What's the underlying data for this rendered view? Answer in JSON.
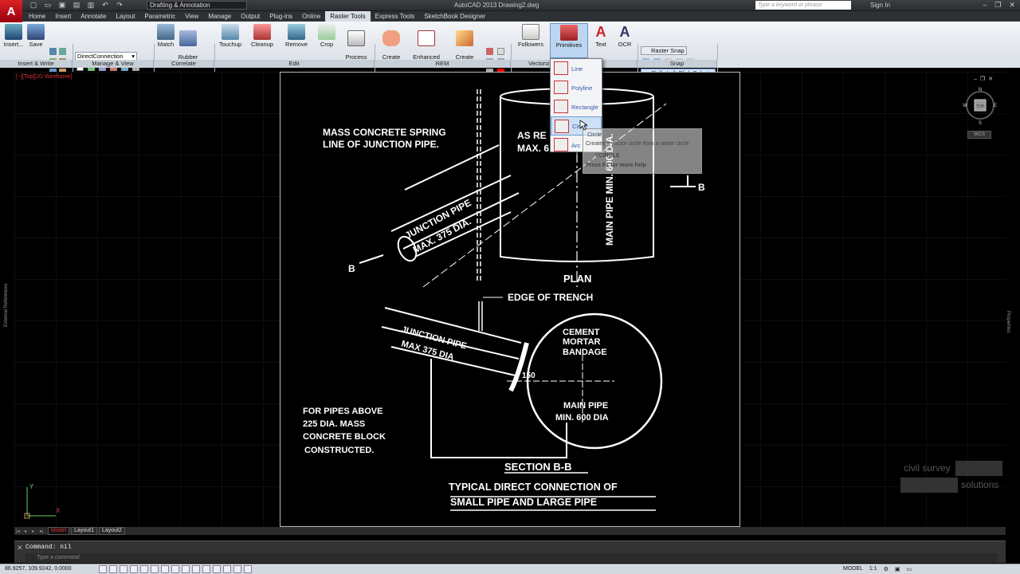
{
  "app": {
    "logo": "A",
    "title": "AutoCAD 2013   Drawing2.dwg",
    "workspace": "Drafting & Annotation",
    "search_placeholder": "Type a keyword or phrase",
    "sign_in": "Sign In"
  },
  "ribbon_tabs": [
    "Home",
    "Insert",
    "Annotate",
    "Layout",
    "Parametric",
    "View",
    "Manage",
    "Output",
    "Plug-ins",
    "Online",
    "Raster Tools",
    "Express Tools",
    "SketchBook Designer"
  ],
  "active_tab": "Raster Tools",
  "ribbon": {
    "insert_label": "Insert...",
    "save_label": "Save",
    "connection_combo": "DirectConnection",
    "match_label": "Match",
    "rubber_label": "Rubber\nSheet",
    "touchup_label": "Touchup",
    "cleanup_label": "Cleanup",
    "remove_label": "Remove",
    "crop_label": "Crop",
    "process_label": "Process\nImage",
    "create_region_label": "Create\nRegion",
    "enhanced_region_label": "Enhanced\nRegion",
    "create_primitive_label": "Create\nPrimitive",
    "followers_label": "Followers",
    "primitives_label": "Primitives",
    "text_label": "Text",
    "ocr_label": "OCR",
    "raster_snap_label": "Raster Snap",
    "shift_select_label": "Shift+Left Click Select",
    "panels": {
      "insert_write": "Insert & Write",
      "manage_view": "Manage & View",
      "correlate": "Correlate",
      "edit": "Edit",
      "rem": "REM",
      "vectorize": "Vectoriz",
      "snap": "Snap"
    }
  },
  "primitives_menu": {
    "items": [
      {
        "label": "Line"
      },
      {
        "label": "Polyline"
      },
      {
        "label": "Rectangle"
      },
      {
        "label": "Circle"
      },
      {
        "label": "Arc"
      }
    ],
    "hovered": "Circle"
  },
  "tooltip": {
    "title": "Circle",
    "description": "Creates a vector circle from a raster circle",
    "command": "VCIRCLE",
    "help": "Press F1 for more help"
  },
  "viewport": {
    "label": "[−][Top][2D Wireframe]",
    "viewcube_top": "TOP",
    "compass": {
      "n": "N",
      "s": "S",
      "e": "E",
      "w": "W"
    },
    "wcs": "WCS"
  },
  "side_palettes": {
    "left": "External References",
    "right": "Properties"
  },
  "drawing_text": {
    "spring_line_1": "MASS CONCRETE SPRING",
    "spring_line_2": "LINE OF JUNCTION PIPE.",
    "as_re": "AS RE",
    "max6": "MAX. 6",
    "junction_pipe_top": "JUNCTION PIPE",
    "max375_top": "MAX. 375 DIA.",
    "main_pipe_top": "MAIN PIPE MIN. 600 DIA.",
    "b_right": "B",
    "b_left": "B",
    "plan": "PLAN",
    "edge_of_trench": "EDGE OF TRENCH",
    "junction_pipe_bottom": "JUNCTION PIPE",
    "max375_bottom": "MAX 375 DIA",
    "cement": "CEMENT",
    "mortar": "MORTAR",
    "bandage": "BANDAGE",
    "dim150": "150",
    "main_pipe_1": "MAIN PIPE",
    "main_pipe_2": "MIN. 600 DIA",
    "pipes_above_1": "FOR PIPES ABOVE",
    "pipes_above_2": "225 DIA. MASS",
    "pipes_above_3": "CONCRETE BLOCK",
    "pipes_above_4": "CONSTRUCTED.",
    "section": "SECTION B-B",
    "caption_1": "TYPICAL DIRECT CONNECTION OF",
    "caption_2": "SMALL PIPE AND LARGE PIPE"
  },
  "watermark": {
    "line1": "civil survey",
    "line2": "solutions"
  },
  "layout_tabs": [
    "Model",
    "Layout1",
    "Layout2"
  ],
  "active_layout": "Model",
  "command": {
    "history": "Command: nil",
    "placeholder": "Type a command"
  },
  "status": {
    "coords": "86.9257, 109.9242, 0.0000",
    "model": "MODEL",
    "scale": "1:1"
  },
  "ucs": {
    "x": "X",
    "y": "Y"
  }
}
